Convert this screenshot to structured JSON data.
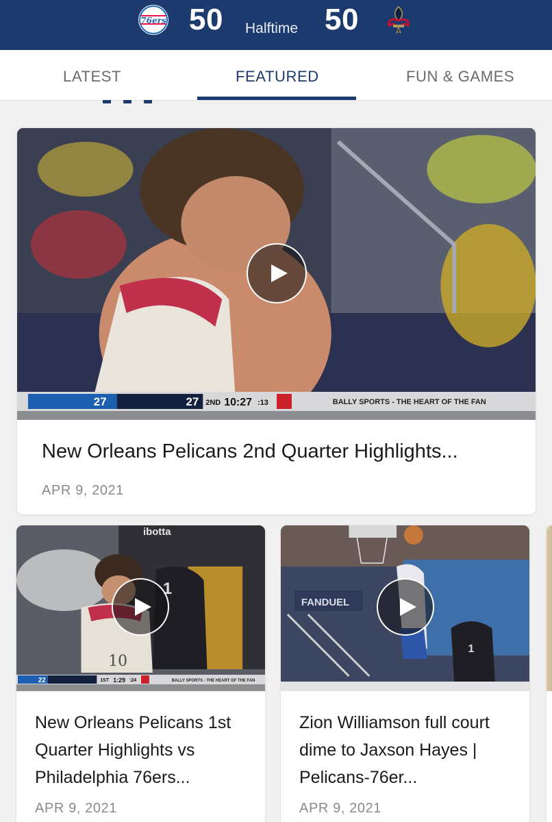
{
  "scoreboard": {
    "home_score": "50",
    "status": "Halftime",
    "away_score": "50",
    "home_logo_text": "76ers"
  },
  "tabs": [
    {
      "label": "LATEST"
    },
    {
      "label": "FEATURED"
    },
    {
      "label": "FUN & GAMES"
    }
  ],
  "colors": {
    "brand_navy": "#1d3a6e",
    "date_gray": "#8a8a8a",
    "tab_inactive": "#6b6b6b"
  },
  "videos": [
    {
      "title": "New Orleans Pelicans 2nd Quarter Highlights...",
      "date": "APR 9, 2021",
      "overlay": {
        "score_a": "27",
        "score_b": "27",
        "period": "2ND",
        "clock": "10:27",
        "shot_clock": ":13",
        "broadcast": "BALLY SPORTS - THE HEART OF THE FAN"
      }
    },
    {
      "title": "New Orleans Pelicans 1st Quarter Highlights vs Philadelphia 76ers...",
      "date": "APR 9, 2021",
      "overlay": {
        "score_a": "22",
        "period": "1ST",
        "clock": "1:29",
        "shot_clock": ":24",
        "broadcast": "BALLY SPORTS - THE HEART OF THE FAN",
        "ad_text": "ibotta",
        "jersey": "10",
        "jersey_2": "1"
      }
    },
    {
      "title": "Zion Williamson full court dime to Jaxson Hayes | Pelicans-76er...",
      "date": "APR 9, 2021",
      "overlay": {
        "ad_text": "FANDUEL",
        "jersey": "1"
      }
    }
  ]
}
